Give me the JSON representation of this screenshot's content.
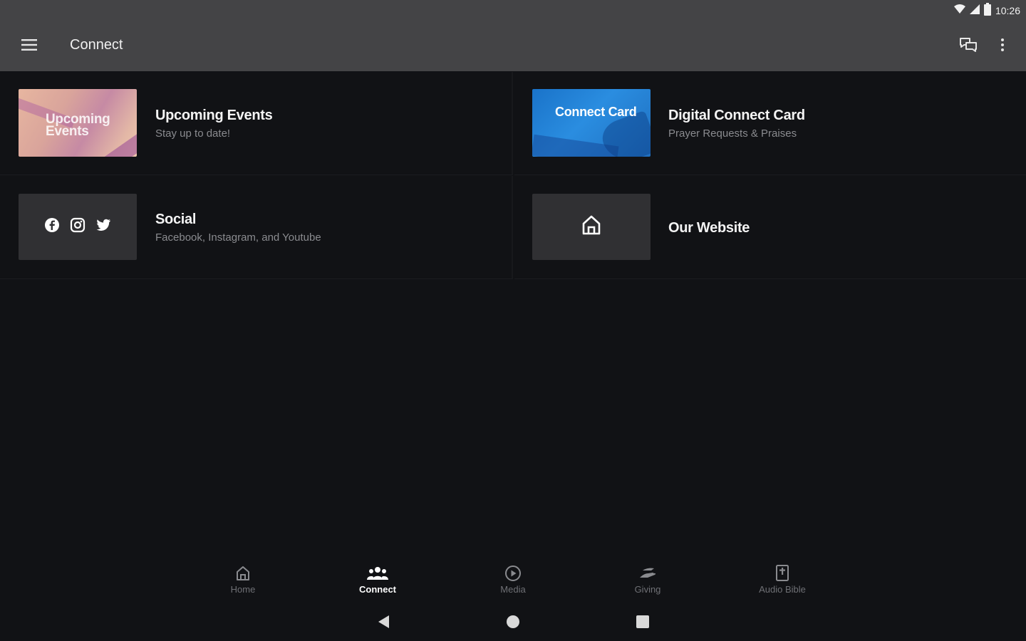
{
  "status_bar": {
    "time": "10:26",
    "icons": [
      "wifi-icon",
      "cell-signal-icon",
      "battery-icon"
    ]
  },
  "app_bar": {
    "title": "Connect",
    "icons": [
      "menu-icon",
      "chat-icon",
      "more-vert-icon"
    ]
  },
  "tiles": [
    {
      "title": "Upcoming Events",
      "subtitle": "Stay up to date!",
      "thumbnail_text": "Upcoming Events"
    },
    {
      "title": "Digital Connect Card",
      "subtitle": "Prayer Requests & Praises",
      "thumbnail_text": "Connect Card"
    },
    {
      "title": "Social",
      "subtitle": "Facebook, Instagram, and Youtube",
      "thumbnail_icons": [
        "facebook-icon",
        "instagram-icon",
        "twitter-icon"
      ]
    },
    {
      "title": "Our Website",
      "thumbnail_icons": [
        "home-icon"
      ]
    }
  ],
  "bottom_nav": {
    "items": [
      {
        "label": "Home",
        "icon": "home-icon"
      },
      {
        "label": "Connect",
        "icon": "people-icon",
        "active": true
      },
      {
        "label": "Media",
        "icon": "play-circle-icon"
      },
      {
        "label": "Giving",
        "icon": "giving-hand-icon"
      },
      {
        "label": "Audio Bible",
        "icon": "bible-icon"
      }
    ]
  },
  "system_nav": [
    "back-icon",
    "home-circle-icon",
    "recents-icon"
  ],
  "colors": {
    "background": "#111215",
    "app_bar": "#444446",
    "tile_placeholder": "#303033",
    "subtitle": "#8a8b8f",
    "nav_inactive": "#6f7075"
  }
}
